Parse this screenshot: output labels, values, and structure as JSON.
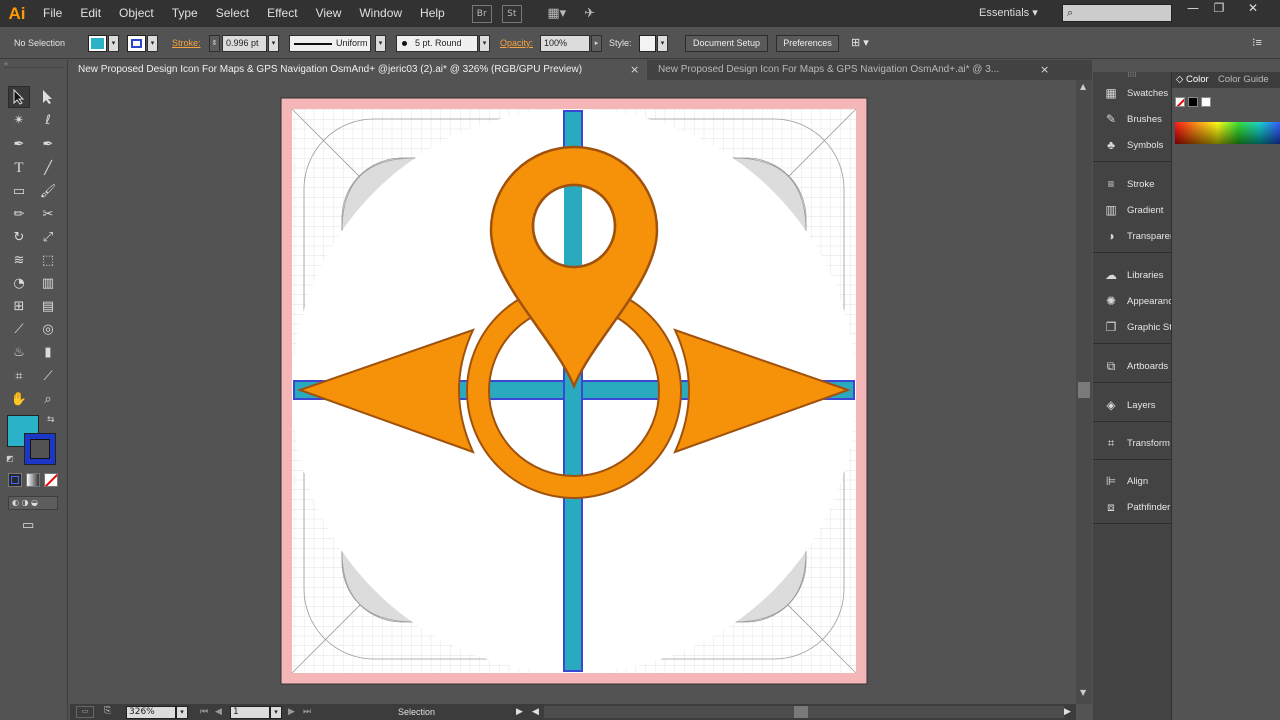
{
  "app": {
    "logo": "Ai",
    "workspace": "Essentials"
  },
  "menu": [
    "File",
    "Edit",
    "Object",
    "Type",
    "Select",
    "Effect",
    "View",
    "Window",
    "Help"
  ],
  "menubar_icons": {
    "bridge": "Br",
    "stock": "St"
  },
  "window_controls": {
    "minimize": "—",
    "restore": "❐",
    "close": "✕"
  },
  "control_bar": {
    "selection_label": "No Selection",
    "stroke_label": "Stroke:",
    "stroke_weight": "0.996 pt",
    "profile": "Uniform",
    "brush": "5 pt. Round",
    "opacity_label": "Opacity:",
    "opacity": "100%",
    "style_label": "Style:",
    "document_setup": "Document Setup",
    "preferences": "Preferences",
    "fill_color": "#29b2c8",
    "stroke_color": "#2f46cc"
  },
  "tabs": [
    {
      "label": "New Proposed Design Icon For Maps & GPS Navigation OsmAnd+ @jeric03 (2).ai* @ 326% (RGB/GPU Preview)",
      "active": true
    },
    {
      "label": "New Proposed Design Icon For Maps & GPS Navigation OsmAnd+.ai* @ 3...",
      "active": false
    }
  ],
  "tab_close": "×",
  "tools": {
    "selection": "selection-arrow-icon",
    "direct_selection": "direct-selection-icon",
    "magic_wand": "magic-wand-icon",
    "lasso": "lasso-icon",
    "pen": "pen-icon",
    "curvature": "curvature-icon",
    "type": "T",
    "line": "line-icon",
    "rectangle": "rectangle-icon",
    "paintbrush": "paintbrush-icon",
    "pencil": "pencil-icon",
    "scissors": "scissors-icon",
    "rotate": "rotate-icon",
    "scale": "scale-icon",
    "width": "width-icon",
    "free_transform": "free-transform-icon",
    "shape_builder": "shape-builder-icon",
    "perspective": "perspective-grid-icon",
    "mesh": "mesh-icon",
    "gradient": "gradient-icon",
    "eyedropper": "eyedropper-icon",
    "blend": "blend-icon",
    "symbol_sprayer": "symbol-sprayer-icon",
    "column_graph": "column-graph-icon",
    "artboard": "artboard-icon",
    "slice": "slice-icon",
    "hand": "hand-icon",
    "zoom": "zoom-icon"
  },
  "artwork": {
    "background_grid": "#e6e6e6",
    "bleed_color": "#f4b6b6",
    "orange": "#f5920a",
    "orange_stroke": "#a0520c",
    "teal": "#2aaabf",
    "blue": "#3b47d4",
    "white": "#ffffff"
  },
  "panels": {
    "dock": [
      "Swatches",
      "Brushes",
      "Symbols",
      "Stroke",
      "Gradient",
      "Transparency",
      "Libraries",
      "Appearance",
      "Graphic Styles",
      "Artboards",
      "Layers",
      "Transform",
      "Align",
      "Pathfinder"
    ],
    "color_tab": "Color",
    "color_guide_tab": "Color Guide"
  },
  "status": {
    "zoom": "326%",
    "artboard": "1",
    "tool": "Selection"
  }
}
